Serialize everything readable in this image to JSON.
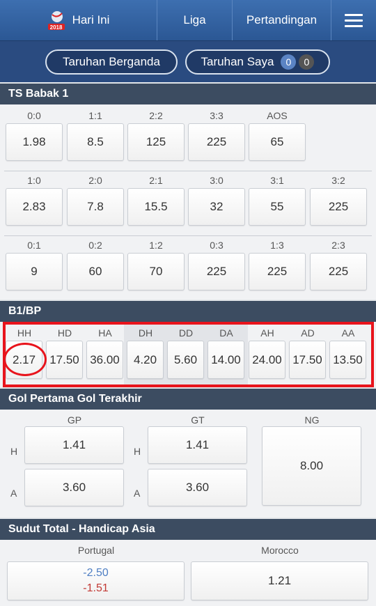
{
  "nav": {
    "home": "Hari Ini",
    "league": "Liga",
    "matches": "Pertandingan",
    "logo_text": "2018"
  },
  "subnav": {
    "multi_bet": "Taruhan Berganda",
    "my_bets": "Taruhan Saya",
    "my_bets_count_a": "0",
    "my_bets_count_b": "0"
  },
  "sections": {
    "ts_half1": {
      "title": "TS Babak 1",
      "rows": [
        [
          {
            "label": "0:0",
            "odds": "1.98"
          },
          {
            "label": "1:1",
            "odds": "8.5"
          },
          {
            "label": "2:2",
            "odds": "125"
          },
          {
            "label": "3:3",
            "odds": "225"
          },
          {
            "label": "AOS",
            "odds": "65"
          }
        ],
        [
          {
            "label": "1:0",
            "odds": "2.83"
          },
          {
            "label": "2:0",
            "odds": "7.8"
          },
          {
            "label": "2:1",
            "odds": "15.5"
          },
          {
            "label": "3:0",
            "odds": "32"
          },
          {
            "label": "3:1",
            "odds": "55"
          },
          {
            "label": "3:2",
            "odds": "225"
          }
        ],
        [
          {
            "label": "0:1",
            "odds": "9"
          },
          {
            "label": "0:2",
            "odds": "60"
          },
          {
            "label": "1:2",
            "odds": "70"
          },
          {
            "label": "0:3",
            "odds": "225"
          },
          {
            "label": "1:3",
            "odds": "225"
          },
          {
            "label": "2:3",
            "odds": "225"
          }
        ]
      ]
    },
    "ht_ft": {
      "title": "B1/BP",
      "cells": [
        {
          "label": "HH",
          "odds": "2.17"
        },
        {
          "label": "HD",
          "odds": "17.50"
        },
        {
          "label": "HA",
          "odds": "36.00"
        },
        {
          "label": "DH",
          "odds": "4.20"
        },
        {
          "label": "DD",
          "odds": "5.60"
        },
        {
          "label": "DA",
          "odds": "14.00"
        },
        {
          "label": "AH",
          "odds": "24.00"
        },
        {
          "label": "AD",
          "odds": "17.50"
        },
        {
          "label": "AA",
          "odds": "13.50"
        }
      ]
    },
    "first_last_goal": {
      "title": "Gol Pertama Gol Terakhir",
      "gp_label": "GP",
      "gt_label": "GT",
      "ng_label": "NG",
      "home_side": "H",
      "away_side": "A",
      "gp_home": "1.41",
      "gp_away": "3.60",
      "gt_home": "1.41",
      "gt_away": "3.60",
      "ng": "8.00"
    },
    "corners": {
      "title": "Sudut Total - Handicap Asia",
      "team_home": "Portugal",
      "team_away": "Morocco",
      "home_line_a": "-2.50",
      "home_line_b": "-1.51",
      "away_odds": "1.21"
    }
  },
  "colors": {
    "nav": "#3a6aab",
    "subnav": "#2a4b80",
    "section_header": "#3c4c61",
    "highlight": "#e8141c",
    "badge_blue": "#5b84c4",
    "badge_gray": "#555555",
    "odds_blue": "#4f7fc4",
    "odds_red": "#c23a35"
  }
}
